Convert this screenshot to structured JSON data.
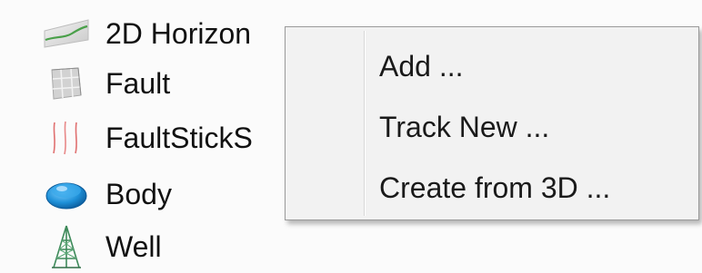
{
  "tree": {
    "items": [
      {
        "label": "2D Horizon",
        "icon": "2d-horizon-icon"
      },
      {
        "label": "Fault",
        "icon": "fault-icon"
      },
      {
        "label": "FaultStickS",
        "icon": "fault-sticks-icon"
      },
      {
        "label": "Body",
        "icon": "body-icon"
      },
      {
        "label": "Well",
        "icon": "well-icon"
      }
    ]
  },
  "context_menu": {
    "items": [
      {
        "label": "Add ..."
      },
      {
        "label": "Track New ..."
      },
      {
        "label": "Create from 3D ..."
      }
    ]
  },
  "colors": {
    "background": "#fbfbfb",
    "menu_background": "#f2f2f2",
    "menu_border": "#9a9a9a",
    "horizon_green": "#4aa04a",
    "fault_sticks_red": "#e07070",
    "body_blue": "#1e90d8",
    "well_green": "#3e8a5a"
  }
}
